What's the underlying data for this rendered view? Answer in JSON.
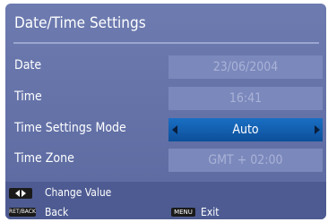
{
  "title": "Date/Time Settings",
  "rows": [
    {
      "label": "Date",
      "value": "23/06/2004"
    },
    {
      "label": "Time",
      "value": "16:41"
    },
    {
      "label": "Time Settings Mode",
      "value": "Auto"
    },
    {
      "label": "Time Zone",
      "value": "GMT + 02:00"
    }
  ],
  "footer": {
    "change_value": "Change Value",
    "back_key": "RET/BACK",
    "back": "Back",
    "menu_key": "MENU",
    "exit": "Exit"
  },
  "colors": {
    "panel": "#5b69a0",
    "selected_row": "#1a6fc4",
    "footer": "#4e5b92"
  }
}
